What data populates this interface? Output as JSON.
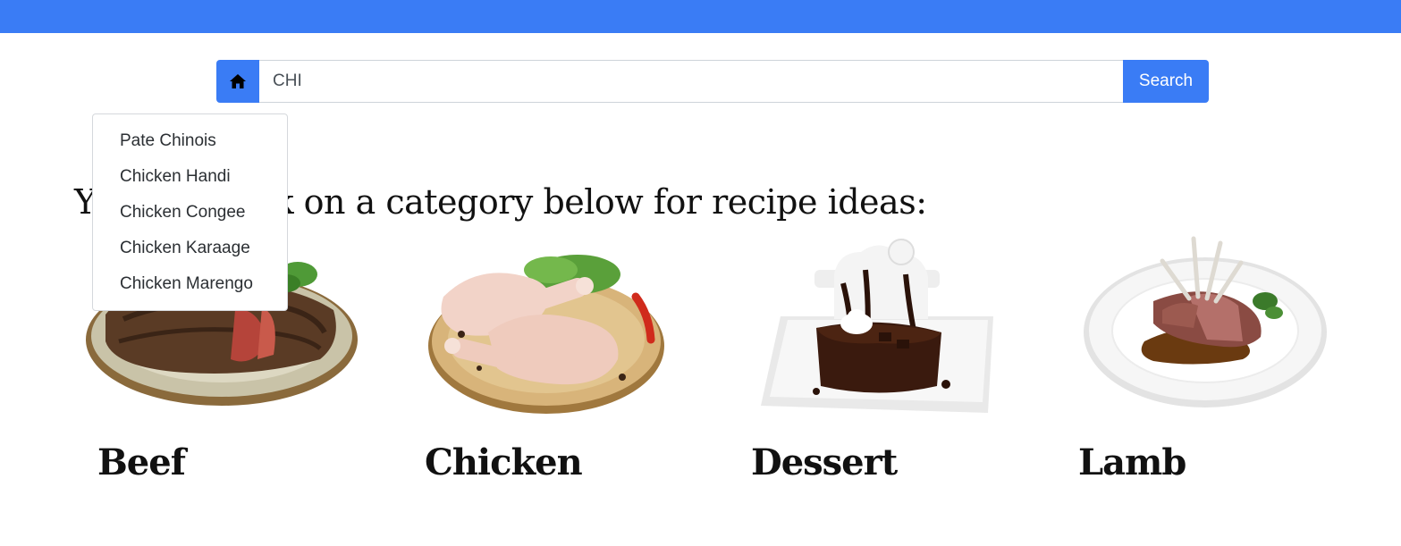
{
  "colors": {
    "accent": "#3a7cf5",
    "text": "#111111"
  },
  "search": {
    "home_icon": "home-icon",
    "value": "CHI",
    "button_label": "Search"
  },
  "heading": "You can click on a category below for recipe ideas:",
  "suggestions": [
    "Pate Chinois",
    "Chicken Handi",
    "Chicken Congee",
    "Chicken Karaage",
    "Chicken Marengo"
  ],
  "categories": [
    {
      "name": "Beef",
      "image": "beef-steak-plate-image"
    },
    {
      "name": "Chicken",
      "image": "chicken-legs-board-image"
    },
    {
      "name": "Dessert",
      "image": "chocolate-cake-plate-image"
    },
    {
      "name": "Lamb",
      "image": "lamb-chops-plate-image"
    }
  ]
}
